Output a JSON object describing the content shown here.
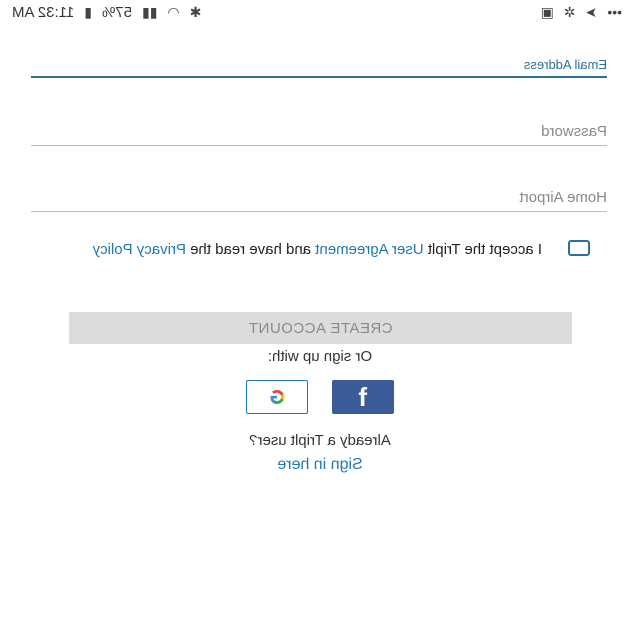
{
  "status_bar": {
    "time": "11:32 AM",
    "battery": "57%",
    "icons_left": [
      "dots-icon",
      "send-icon",
      "pinwheel-icon",
      "image-icon"
    ],
    "icons_right": [
      "bluetooth-icon",
      "wifi-icon",
      "signal-icon",
      "battery-icon"
    ]
  },
  "form": {
    "email_label": "Email Address",
    "password_label": "Password",
    "airport_label": "Home Airport"
  },
  "agreement": {
    "text_1": "I accept the Triplt ",
    "link_1": "User Agreement",
    "text_2": " and have read the ",
    "link_2": "Privacy Policy",
    "checked": false
  },
  "create_button": "CREATE ACCOUNT",
  "or_sign_up": "Or sign up with:",
  "social": {
    "google": "G",
    "facebook": "f"
  },
  "already": "Already a Triplt user?",
  "sign_in_link": "Sign in here",
  "colors": {
    "accent": "#1e78b4",
    "button_disabled": "#dcdcdc",
    "facebook": "#3b5b99"
  }
}
